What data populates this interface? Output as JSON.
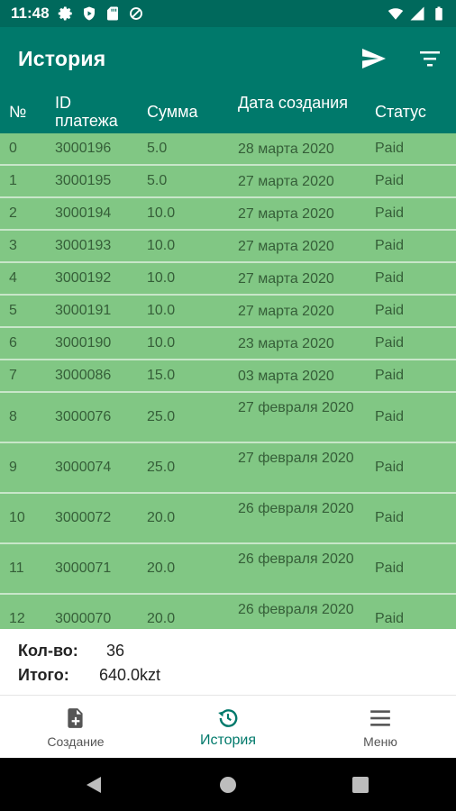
{
  "status_bar": {
    "time": "11:48"
  },
  "app_bar": {
    "title": "История"
  },
  "table": {
    "headers": {
      "num": "№",
      "id": "ID платежа",
      "sum": "Сумма",
      "date": "Дата создания",
      "status": "Статус"
    },
    "rows": [
      {
        "num": "0",
        "id": "3000196",
        "sum": "5.0",
        "date": "28 марта 2020",
        "status": "Paid"
      },
      {
        "num": "1",
        "id": "3000195",
        "sum": "5.0",
        "date": "27 марта 2020",
        "status": "Paid"
      },
      {
        "num": "2",
        "id": "3000194",
        "sum": "10.0",
        "date": "27 марта 2020",
        "status": "Paid"
      },
      {
        "num": "3",
        "id": "3000193",
        "sum": "10.0",
        "date": "27 марта 2020",
        "status": "Paid"
      },
      {
        "num": "4",
        "id": "3000192",
        "sum": "10.0",
        "date": "27 марта 2020",
        "status": "Paid"
      },
      {
        "num": "5",
        "id": "3000191",
        "sum": "10.0",
        "date": "27 марта 2020",
        "status": "Paid"
      },
      {
        "num": "6",
        "id": "3000190",
        "sum": "10.0",
        "date": "23 марта 2020",
        "status": "Paid"
      },
      {
        "num": "7",
        "id": "3000086",
        "sum": "15.0",
        "date": "03 марта 2020",
        "status": "Paid"
      },
      {
        "num": "8",
        "id": "3000076",
        "sum": "25.0",
        "date": "27 февраля 2020",
        "status": "Paid"
      },
      {
        "num": "9",
        "id": "3000074",
        "sum": "25.0",
        "date": "27 февраля 2020",
        "status": "Paid"
      },
      {
        "num": "10",
        "id": "3000072",
        "sum": "20.0",
        "date": "26 февраля 2020",
        "status": "Paid"
      },
      {
        "num": "11",
        "id": "3000071",
        "sum": "20.0",
        "date": "26 февраля 2020",
        "status": "Paid"
      },
      {
        "num": "12",
        "id": "3000070",
        "sum": "20.0",
        "date": "26 февраля 2020",
        "status": "Paid"
      }
    ]
  },
  "summary": {
    "count_label": "Кол-во:",
    "count_value": "36",
    "total_label": "Итого:",
    "total_value": "640.0kzt"
  },
  "bottom_nav": {
    "items": [
      {
        "label": "Создание",
        "icon": "file-plus-icon"
      },
      {
        "label": "История",
        "icon": "history-icon"
      },
      {
        "label": "Меню",
        "icon": "menu-icon"
      }
    ]
  },
  "colors": {
    "primary": "#00796B",
    "primary_dark": "#00695C",
    "row_bg": "#81C784",
    "row_divider": "#C8E6C9"
  }
}
